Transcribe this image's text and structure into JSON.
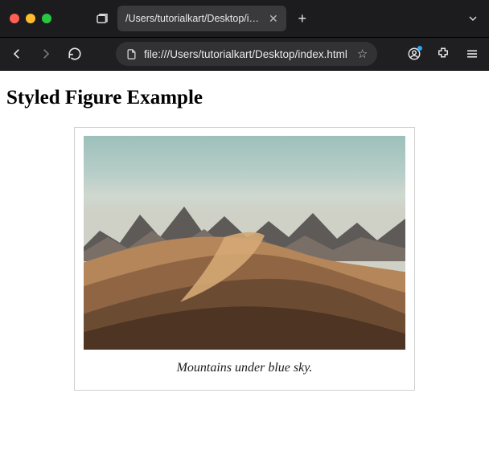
{
  "window": {
    "traffic_colors": {
      "close": "#ff5f57",
      "min": "#febc2e",
      "max": "#28c840"
    }
  },
  "tab": {
    "title": "/Users/tutorialkart/Desktop/index.ht"
  },
  "url": {
    "text": "file:///Users/tutorialkart/Desktop/index.html"
  },
  "page": {
    "heading": "Styled Figure Example",
    "figcaption": "Mountains under blue sky."
  }
}
